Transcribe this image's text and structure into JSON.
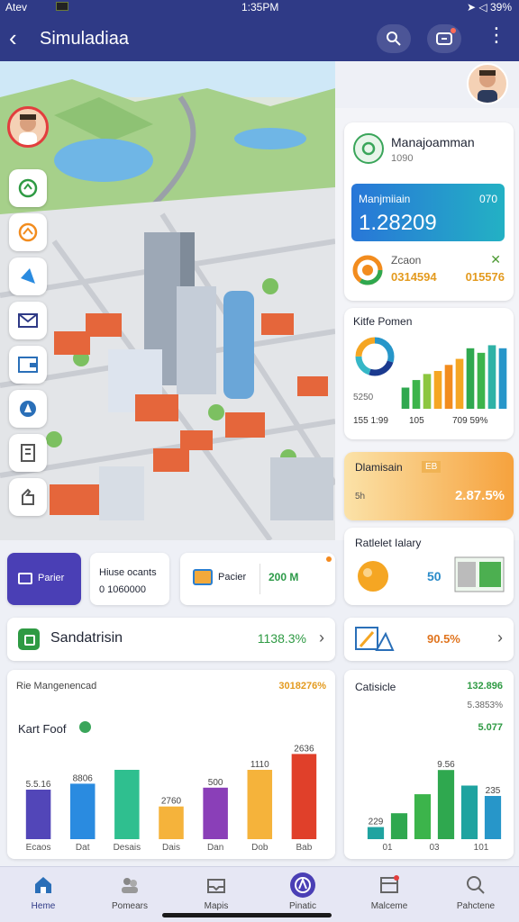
{
  "status_bar": {
    "carrier": "Atev",
    "time": "1:35PM",
    "battery": "39%"
  },
  "app_bar": {
    "back_glyph": "‹",
    "title": "Simuladiaa",
    "more_glyph": "⋮"
  },
  "management_card": {
    "title": "Manajoamman",
    "subtitle": "1090",
    "blue_label": "Manjmiiain",
    "blue_right": "070",
    "blue_value": "1.28209",
    "ring_label": "Zcaon",
    "ring_value": "0314594",
    "ring_right": "015576",
    "ring_mark": "✕"
  },
  "chart_card_1": {
    "title": "Kitfe Pomen",
    "side_value": "5250",
    "footer": [
      "155 1:99",
      "105",
      "709 59%"
    ],
    "chart_data": {
      "type": "bar",
      "values": [
        28,
        38,
        46,
        50,
        58,
        66,
        80,
        74,
        84,
        80
      ],
      "colors": [
        "#2fa84f",
        "#3cb44b",
        "#8cc63f",
        "#f5a623",
        "#f28c1e",
        "#f5a623",
        "#2fa84f",
        "#3cb44b",
        "#2fb2a6",
        "#2796c9"
      ],
      "ylim": [
        0,
        100
      ]
    },
    "donut": {
      "segments": [
        30,
        25,
        20,
        25
      ],
      "colors": [
        "#2796c9",
        "#1b3a8f",
        "#36b7c7",
        "#f5a623"
      ]
    }
  },
  "orange_card": {
    "title": "Dlamisain",
    "tag": "EB",
    "sub": "5h",
    "value": "2.87.5%"
  },
  "tally_card": {
    "title": "Ratlelet Ialary",
    "value": "50"
  },
  "action_row": {
    "primary_label": "Parier",
    "mini_label": "Hiuse ocants",
    "mini_value": "0 1060000",
    "media_label": "Pacier",
    "media_value": "200 M"
  },
  "sand_row": {
    "label": "Sandatrisin",
    "value": "1138.3%",
    "chevron": "›"
  },
  "right_row": {
    "value": "90.5%",
    "chevron": "›"
  },
  "bottom_chart": {
    "title": "Rie Mangenencad",
    "top_value": "3018276%",
    "subtitle": "Kart Foof",
    "chart_data": {
      "type": "bar",
      "categories": [
        "Ecaos",
        "Dat",
        "Desais",
        "Dais",
        "Dan",
        "Dob",
        "Bab"
      ],
      "values": [
        50,
        56,
        70,
        33,
        52,
        70,
        86
      ],
      "labels": [
        "5.5.16",
        "8806",
        "",
        "2760",
        "500",
        "1110",
        "2636"
      ],
      "colors": [
        "#5246b8",
        "#2a8be0",
        "#2fbf8f",
        "#f5b33b",
        "#8a3fb8",
        "#f5b33b",
        "#e0402a"
      ],
      "ylim": [
        0,
        100
      ]
    }
  },
  "stat_chart": {
    "title": "Catisicle",
    "right_value_1": "132.896",
    "right_value_2": "5.3853%",
    "right_value_3": "5.077",
    "chart_data": {
      "type": "bar",
      "categories": [
        "01",
        "03",
        "101"
      ],
      "values": [
        14,
        30,
        52,
        80,
        62,
        50
      ],
      "labels": [
        "229",
        "",
        "",
        "9.56",
        "",
        "235"
      ],
      "colors": [
        "#1fa3a0",
        "#2fa84f",
        "#3cb44b",
        "#2fa84f",
        "#1fa3a0",
        "#2796c9"
      ],
      "ylim": [
        0,
        100
      ]
    }
  },
  "bottom_nav": [
    {
      "label": "Heme",
      "icon": "home-icon",
      "active": true
    },
    {
      "label": "Pomears",
      "icon": "people-icon",
      "active": false
    },
    {
      "label": "Mapis",
      "icon": "inbox-icon",
      "active": false
    },
    {
      "label": "Pinatic",
      "icon": "compass-icon",
      "active": false
    },
    {
      "label": "Malceme",
      "icon": "window-icon",
      "active": false
    },
    {
      "label": "Pahctene",
      "icon": "search-icon",
      "active": false
    }
  ]
}
